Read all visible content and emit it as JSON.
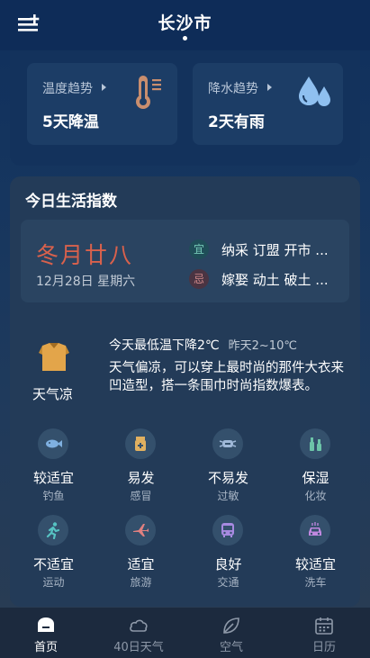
{
  "header": {
    "city": "长沙市"
  },
  "trends": [
    {
      "label": "温度趋势",
      "value": "5天降温",
      "icon": "thermometer-icon"
    },
    {
      "label": "降水趋势",
      "value": "2天有雨",
      "icon": "raindrops-icon"
    }
  ],
  "life": {
    "title": "今日生活指数",
    "almanac": {
      "lunar": "冬月廿八",
      "solar": "12月28日 星期六",
      "yi_badge": "宜",
      "yi_text": "纳采 订盟 开市 ...",
      "ji_badge": "忌",
      "ji_text": "嫁娶 动土 破土 ..."
    },
    "dressing": {
      "level": "天气凉",
      "headline": "今天最低温下降2℃",
      "yesterday": "昨天2~10℃",
      "description": "天气偏凉，可以穿上最时尚的那件大衣来凹造型，搭一条围巾时尚指数爆表。"
    },
    "indices": [
      {
        "level": "较适宜",
        "name": "钓鱼",
        "icon": "fish-icon",
        "color": "#7fb0e0"
      },
      {
        "level": "易发",
        "name": "感冒",
        "icon": "medicine-icon",
        "color": "#e0b060"
      },
      {
        "level": "不易发",
        "name": "过敏",
        "icon": "mask-icon",
        "color": "#9fb8d8"
      },
      {
        "level": "保湿",
        "name": "化妆",
        "icon": "cosmetics-icon",
        "color": "#6cc4a8"
      },
      {
        "level": "不适宜",
        "name": "运动",
        "icon": "running-icon",
        "color": "#56c2c2"
      },
      {
        "level": "适宜",
        "name": "旅游",
        "icon": "plane-icon",
        "color": "#e08080"
      },
      {
        "level": "良好",
        "name": "交通",
        "icon": "bus-icon",
        "color": "#a78ae0"
      },
      {
        "level": "较适宜",
        "name": "洗车",
        "icon": "car-icon",
        "color": "#c088e0"
      }
    ]
  },
  "nav": [
    {
      "label": "首页",
      "icon": "home-icon"
    },
    {
      "label": "40日天气",
      "icon": "cloud-icon"
    },
    {
      "label": "空气",
      "icon": "leaf-icon"
    },
    {
      "label": "日历",
      "icon": "calendar-icon"
    }
  ]
}
